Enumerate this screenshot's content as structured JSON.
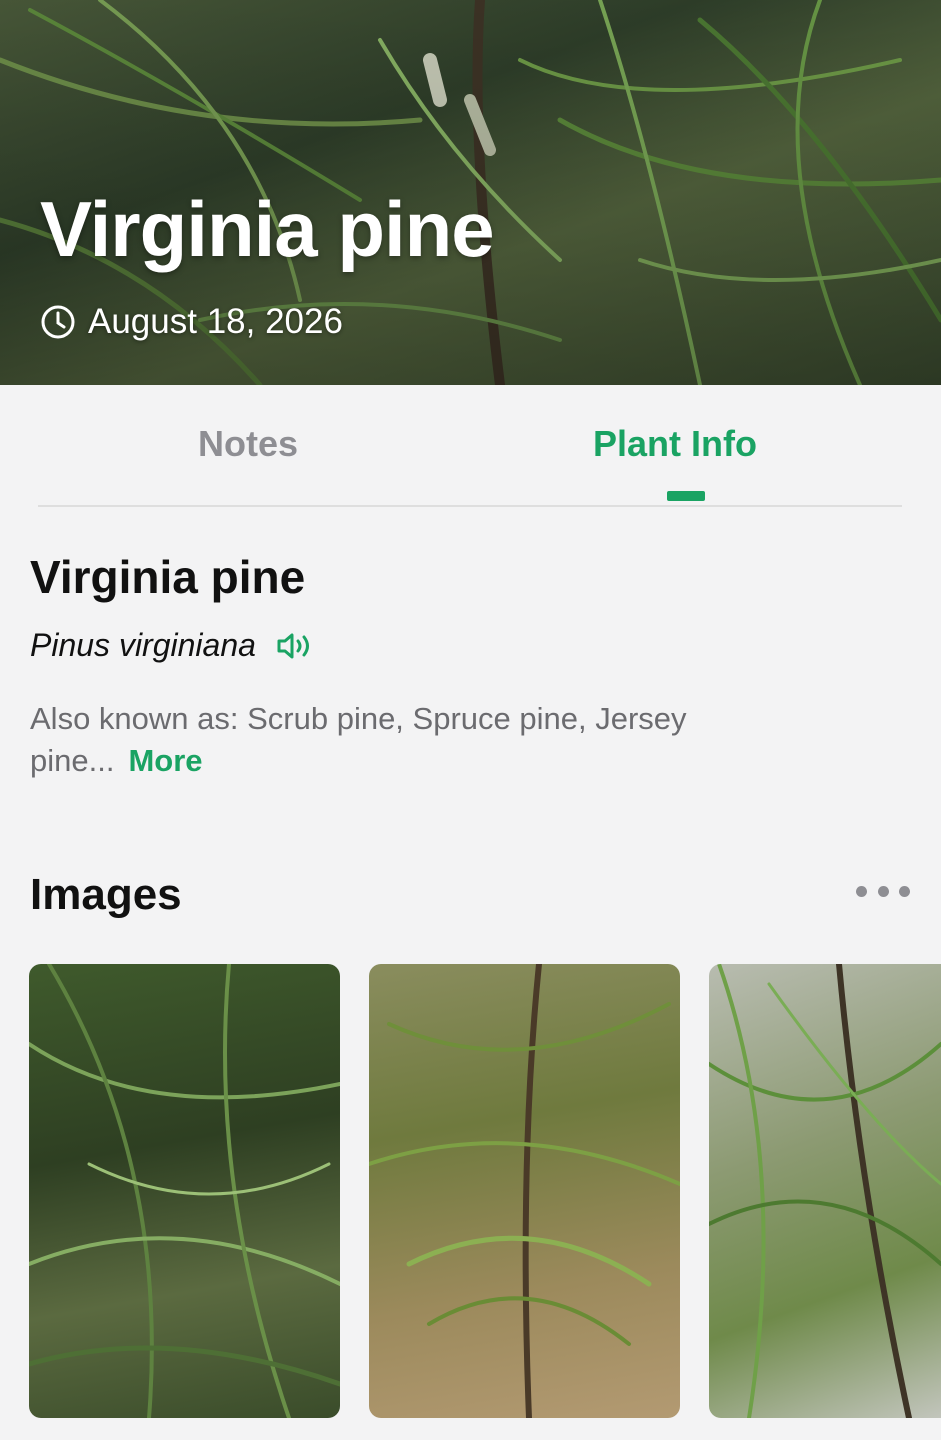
{
  "hero": {
    "title": "Virginia pine",
    "date": "August 18, 2026",
    "date_icon": "clock-icon"
  },
  "tabs": [
    {
      "label": "Notes",
      "active": false
    },
    {
      "label": "Plant Info",
      "active": true
    }
  ],
  "plant": {
    "common_name": "Virginia pine",
    "scientific_name": "Pinus virginiana",
    "pronounce_icon": "speaker-icon",
    "also_known_as": "Also known as: Scrub pine, Spruce pine, Jersey pine...",
    "more_label": "More"
  },
  "images_section": {
    "title": "Images",
    "menu_icon": "more-horizontal-icon",
    "images": [
      {
        "description": "pine branches close-up"
      },
      {
        "description": "young pine sapling"
      },
      {
        "description": "pine needles cluster"
      }
    ]
  },
  "colors": {
    "accent": "#1aa363",
    "background": "#f3f3f4",
    "muted_text": "#8e8e93"
  }
}
